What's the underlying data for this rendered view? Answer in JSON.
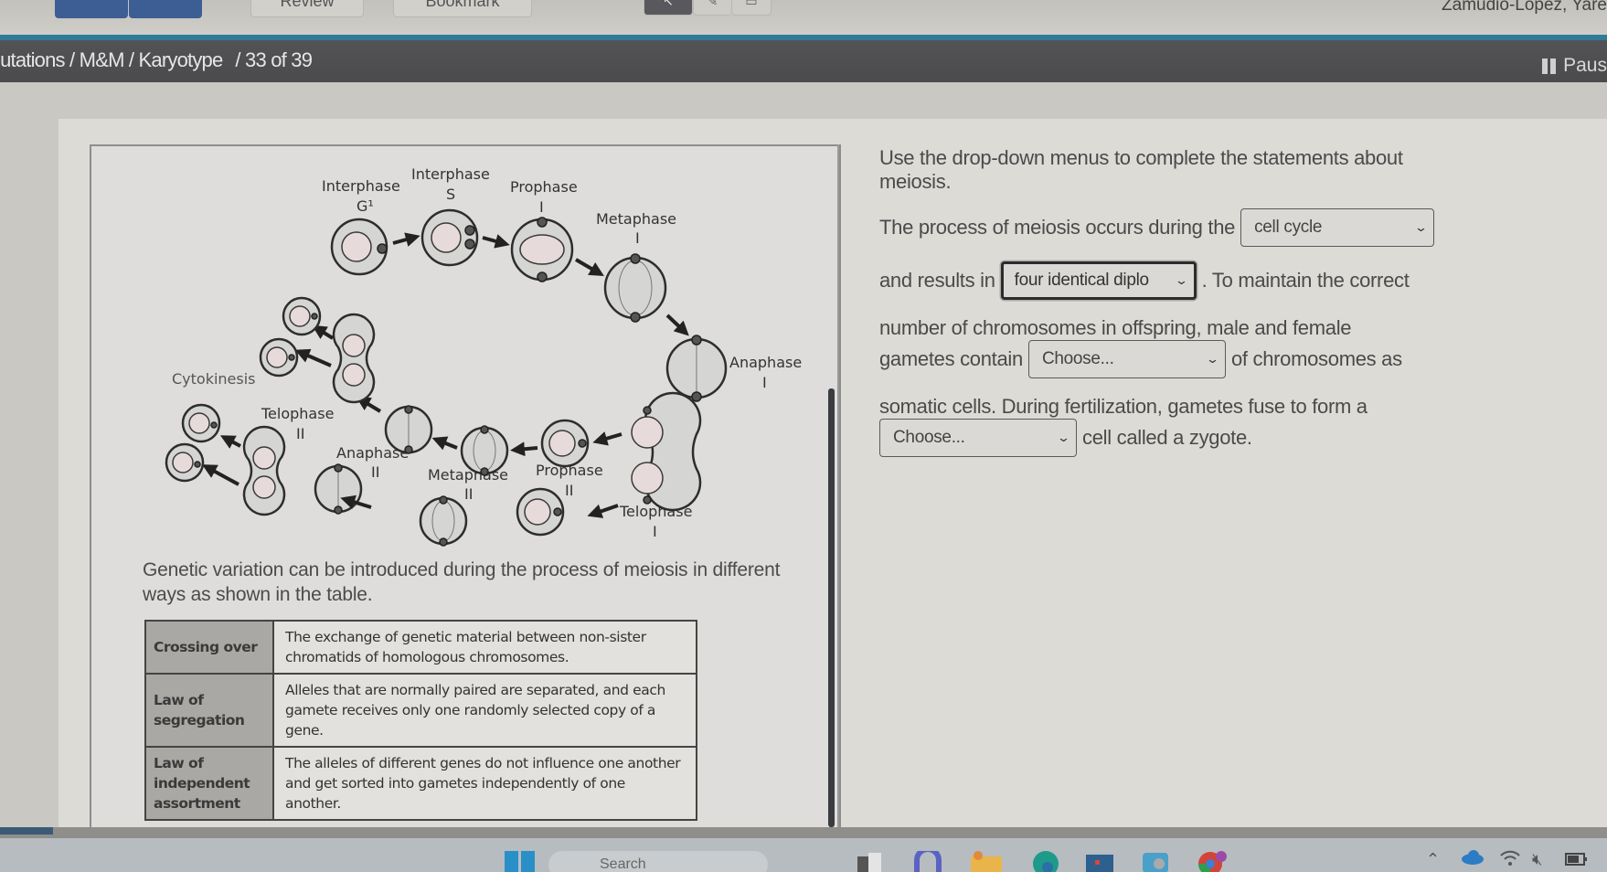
{
  "toolbar": {
    "review_label": "Review",
    "bookmark_label": "Bookmark",
    "user_name": "Zamudio-Lopez, Yare"
  },
  "breadcrumb": {
    "path": "lutations / M&M / Karyotype",
    "page_counter": "/ 33 of 39"
  },
  "pause_label": "Paus",
  "diagram": {
    "labels": {
      "interphase_g1": "Interphase",
      "interphase_g1_sub": "G¹",
      "interphase_s": "Interphase",
      "interphase_s_sub": "S",
      "prophase_1": "Prophase",
      "prophase_1_sub": "I",
      "metaphase_1": "Metaphase",
      "metaphase_1_sub": "I",
      "anaphase_1": "Anaphase",
      "anaphase_1_sub": "I",
      "telophase_1": "Telophase",
      "telophase_1_sub": "I",
      "prophase_2": "Prophase",
      "prophase_2_sub": "II",
      "metaphase_2": "Metaphase",
      "metaphase_2_sub": "II",
      "anaphase_2": "Anaphase",
      "anaphase_2_sub": "II",
      "telophase_2": "Telophase",
      "telophase_2_sub": "II",
      "cytokinesis": "Cytokinesis"
    }
  },
  "intro_text": "Genetic variation can be introduced during the process of meiosis in different ways as shown in the table.",
  "variation_table": [
    {
      "term": "Crossing over",
      "definition": "The exchange of genetic material between non-sister chromatids of homologous chromosomes."
    },
    {
      "term": "Law of segregation",
      "definition": "Alleles that are normally paired are separated, and each gamete receives only one randomly selected copy of a gene."
    },
    {
      "term": "Law of independent assortment",
      "definition": "The alleles of different genes do not influence one another and get sorted into gametes independently of one another."
    }
  ],
  "question": {
    "instruction": "Use the drop-down menus to complete the statements about meiosis.",
    "s1_before": "The process of meiosis occurs during the",
    "dropdown1_value": "cell cycle",
    "s2_before": "and results in",
    "dropdown2_value": "four identical diplo",
    "s2_after": ". To maintain the correct",
    "s3_line": "number of chromosomes in offspring, male and female",
    "s4_before": "gametes contain",
    "dropdown3_value": "Choose...",
    "s4_after": "of chromosomes as",
    "s5_line": "somatic cells. During fertilization, gametes fuse to form a",
    "dropdown4_value": "Choose...",
    "s6_after": "cell called a zygote."
  },
  "progress": {
    "fraction": 0.033
  },
  "taskbar": {
    "search_placeholder": "Search"
  }
}
